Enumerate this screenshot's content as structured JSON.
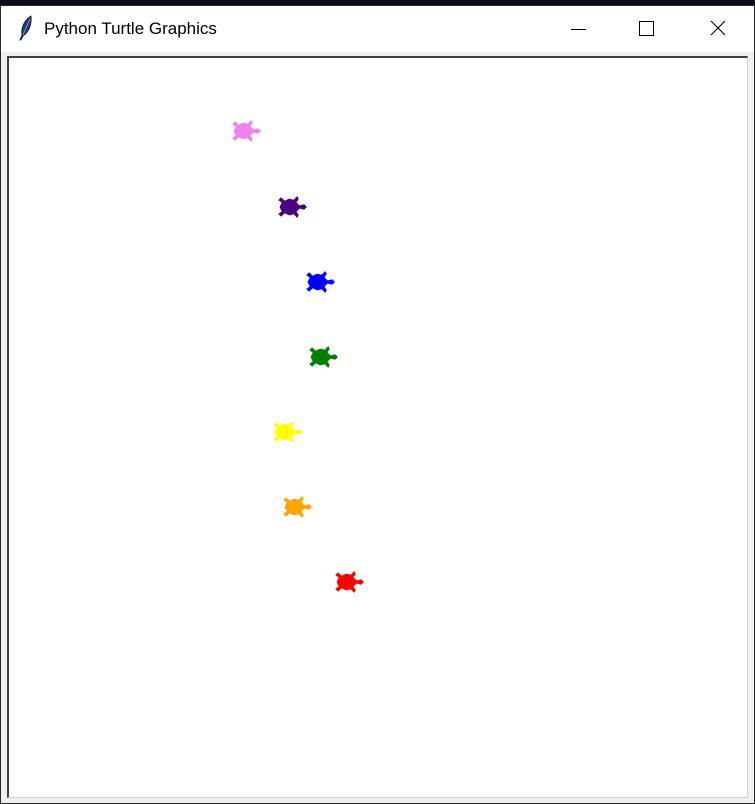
{
  "window": {
    "title": "Python Turtle Graphics",
    "icon": "feather-icon"
  },
  "controls": {
    "minimize": "minimize-icon",
    "maximize": "maximize-icon",
    "close": "close-icon"
  },
  "canvas": {
    "background": "#ffffff",
    "turtles": [
      {
        "color": "#ee82ee",
        "name": "violet"
      },
      {
        "color": "#4b0082",
        "name": "indigo"
      },
      {
        "color": "#0000ff",
        "name": "blue"
      },
      {
        "color": "#008000",
        "name": "green"
      },
      {
        "color": "#ffff00",
        "name": "yellow"
      },
      {
        "color": "#ffa500",
        "name": "orange"
      },
      {
        "color": "#ff0000",
        "name": "red"
      }
    ]
  }
}
